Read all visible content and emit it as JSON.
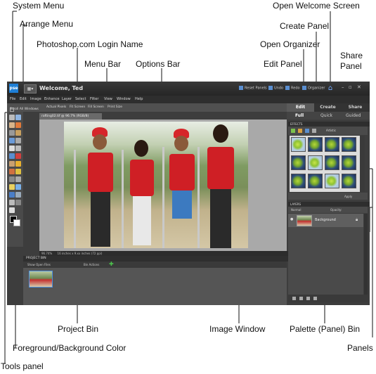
{
  "callouts": {
    "system_menu": "System Menu",
    "arrange_menu": "Arrange Menu",
    "login_name": "Photoshop.com Login Name",
    "menu_bar": "Menu Bar",
    "options_bar": "Options Bar",
    "open_welcome": "Open Welcome Screen",
    "create_panel": "Create Panel",
    "open_organizer": "Open Organizer",
    "edit_panel": "Edit Panel",
    "share_panel_1": "Share",
    "share_panel_2": "Panel",
    "project_bin": "Project Bin",
    "image_window": "Image Window",
    "palette_bin": "Palette (Panel) Bin",
    "panels": "Panels",
    "fg_bg_color": "Foreground/Background Color",
    "tools_panel": "Tools panel"
  },
  "app": {
    "logo": "pse",
    "welcome": "Welcome, Ted",
    "titlebar_buttons": [
      "Reset Panels",
      "Undo",
      "Redo",
      "Organizer"
    ],
    "menu": [
      "File",
      "Edit",
      "Image",
      "Enhance",
      "Layer",
      "Select",
      "Filter",
      "View",
      "Window",
      "Help"
    ],
    "options": [
      "Scroll All Windows",
      "Actual Pixels",
      "Fit Screen",
      "Fill Screen",
      "Print Size"
    ],
    "panel_tabs": [
      "Edit",
      "Create",
      "Share"
    ],
    "panel_subtabs": [
      "Full",
      "Quick",
      "Guided"
    ],
    "document_tab": "rafting02.tif @ 96.7% (RGB/8)",
    "status": "96.74%",
    "status_detail": "16 inches x 9.xx inches (72 ppi)",
    "project_bin_title": "PROJECT BIN",
    "bin_options": [
      "Show Open Files",
      "Bin Actions"
    ],
    "effects_title": "EFFECTS",
    "effects_filter": "Artistic",
    "effects_apply": "Apply",
    "layers_title": "LAYERS",
    "layers_mode": "Normal",
    "layers_opacity": "Opacity:",
    "layer_name": "Background"
  },
  "colors": {
    "accent": "#1e7fd6",
    "vest": "#cf1f25",
    "app_bg": "#3d3d3d"
  }
}
